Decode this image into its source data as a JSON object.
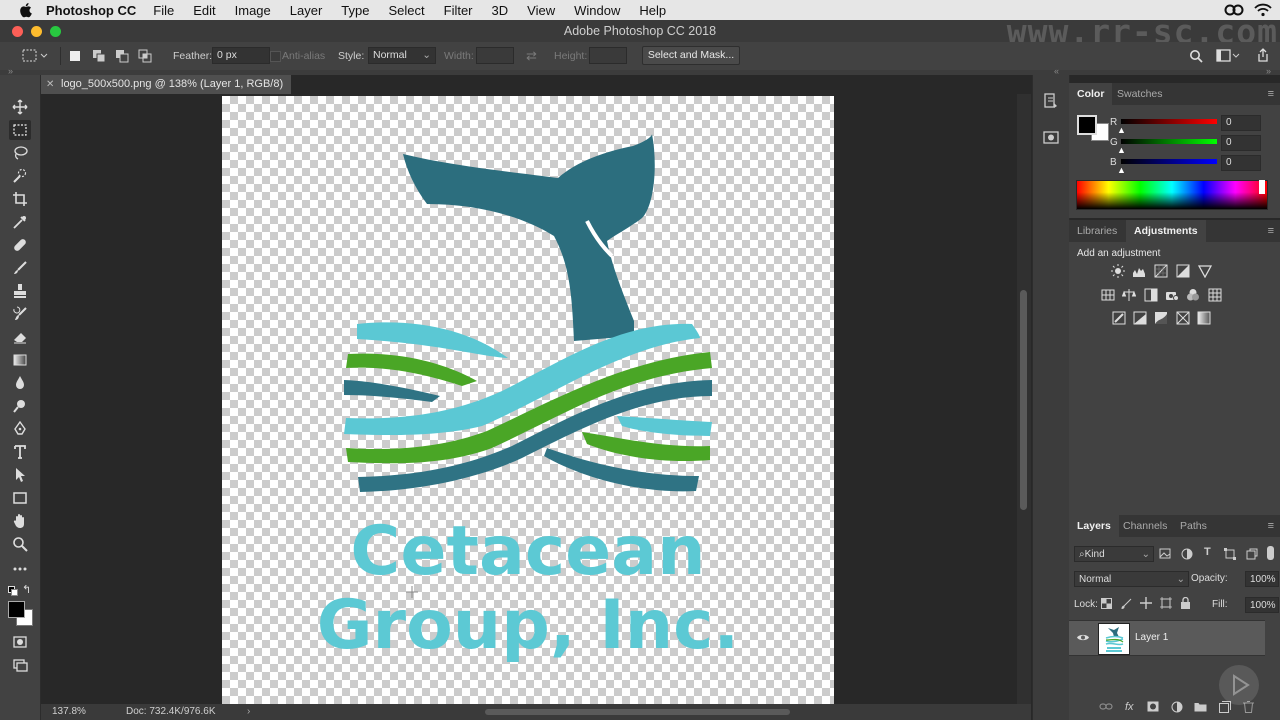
{
  "menubar": {
    "app_name": "Photoshop CC",
    "items": [
      "File",
      "Edit",
      "Image",
      "Layer",
      "Type",
      "Select",
      "Filter",
      "3D",
      "View",
      "Window",
      "Help"
    ]
  },
  "window": {
    "title": "Adobe Photoshop CC 2018",
    "watermark": "www.rr-sc.com"
  },
  "options_bar": {
    "feather_label": "Feather:",
    "feather_value": "0 px",
    "antialias_label": "Anti-alias",
    "style_label": "Style:",
    "style_value": "Normal",
    "width_label": "Width:",
    "height_label": "Height:",
    "select_mask_label": "Select and Mask..."
  },
  "document": {
    "tab_title": "logo_500x500.png @ 138% (Layer 1, RGB/8)",
    "logo_line1": "Cetacean",
    "logo_line2": "Group, Inc.",
    "zoom": "137.8%",
    "doc_size": "Doc: 732.4K/976.6K"
  },
  "color_panel": {
    "tabs": [
      "Color",
      "Swatches"
    ],
    "channels": [
      {
        "label": "R",
        "value": "0"
      },
      {
        "label": "G",
        "value": "0"
      },
      {
        "label": "B",
        "value": "0"
      }
    ],
    "foreground": "#000000",
    "background": "#ffffff"
  },
  "adjustments_panel": {
    "tabs": [
      "Libraries",
      "Adjustments"
    ],
    "heading": "Add an adjustment"
  },
  "layers_panel": {
    "tabs": [
      "Layers",
      "Channels",
      "Paths"
    ],
    "kind_label": "Kind",
    "blend_mode": "Normal",
    "opacity_label": "Opacity:",
    "opacity_value": "100%",
    "lock_label": "Lock:",
    "fill_label": "Fill:",
    "fill_value": "100%",
    "layers": [
      {
        "name": "Layer 1",
        "visible": true
      }
    ]
  },
  "colors": {
    "whale_tail": "#2c6e7e",
    "wave_light": "#5bc8d4",
    "wave_green": "#4aa626",
    "wave_dark": "#2f7384",
    "text": "#5cc9d4"
  }
}
